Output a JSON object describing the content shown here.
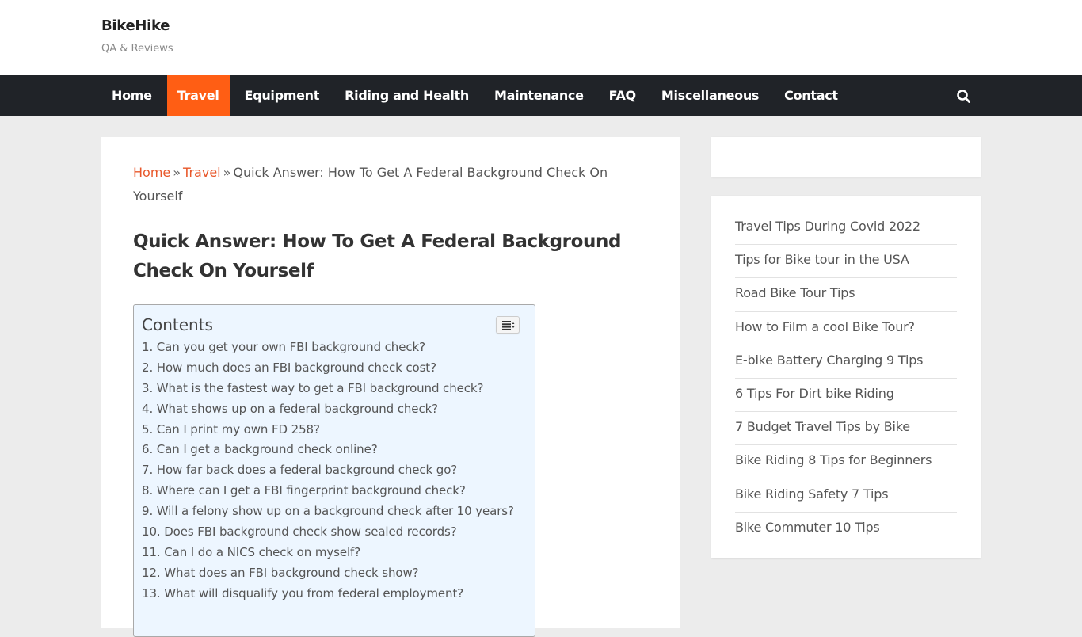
{
  "site": {
    "title": "BikeHike",
    "tagline": "QA & Reviews"
  },
  "nav": {
    "items": [
      {
        "label": "Home",
        "active": false
      },
      {
        "label": "Travel",
        "active": true
      },
      {
        "label": "Equipment",
        "active": false
      },
      {
        "label": "Riding and Health",
        "active": false
      },
      {
        "label": "Maintenance",
        "active": false
      },
      {
        "label": "FAQ",
        "active": false
      },
      {
        "label": "Miscellaneous",
        "active": false
      },
      {
        "label": "Contact",
        "active": false
      }
    ],
    "search_icon": "search-icon",
    "accent_color": "#ff5e14"
  },
  "breadcrumb": {
    "home": "Home",
    "separator": "»",
    "category": "Travel",
    "current": "Quick Answer: How To Get A Federal Background Check On Yourself"
  },
  "post": {
    "title": "Quick Answer: How To Get A Federal Background Check On Yourself"
  },
  "toc": {
    "title": "Contents",
    "toggle_icon": "list-toggle-icon",
    "items": [
      "1. Can you get your own FBI background check?",
      "2. How much does an FBI background check cost?",
      "3. What is the fastest way to get a FBI background check?",
      "4. What shows up on a federal background check?",
      "5. Can I print my own FD 258?",
      "6. Can I get a background check online?",
      "7. How far back does a federal background check go?",
      "8. Where can I get a FBI fingerprint background check?",
      "9. Will a felony show up on a background check after 10 years?",
      "10. Does FBI background check show sealed records?",
      "11. Can I do a NICS check on myself?",
      "12. What does an FBI background check show?",
      "13. What will disqualify you from federal employment?"
    ]
  },
  "sidebar": {
    "links": [
      "Travel Tips During Covid 2022",
      "Tips for Bike tour in the USA",
      "Road Bike Tour Tips",
      "How to Film a cool Bike Tour?",
      "E-bike Battery Charging 9 Tips",
      "6 Tips For Dirt bike Riding",
      "7 Budget Travel Tips by Bike",
      "Bike Riding 8 Tips for Beginners",
      "Bike Riding Safety 7 Tips",
      "Bike Commuter 10 Tips"
    ]
  }
}
